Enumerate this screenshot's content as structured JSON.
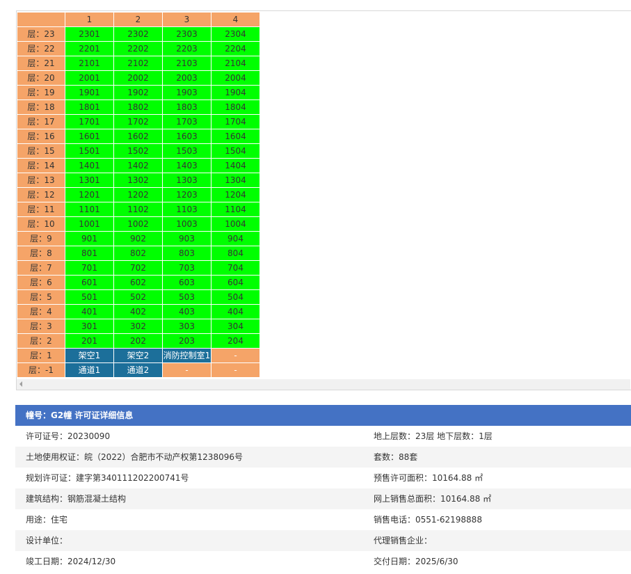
{
  "grid": {
    "columns": [
      "1",
      "2",
      "3",
      "4"
    ],
    "rows": [
      {
        "floor": "层：23",
        "units": [
          {
            "t": "2301",
            "s": "g"
          },
          {
            "t": "2302",
            "s": "g"
          },
          {
            "t": "2303",
            "s": "g"
          },
          {
            "t": "2304",
            "s": "g"
          }
        ]
      },
      {
        "floor": "层：22",
        "units": [
          {
            "t": "2201",
            "s": "g"
          },
          {
            "t": "2202",
            "s": "g"
          },
          {
            "t": "2203",
            "s": "g"
          },
          {
            "t": "2204",
            "s": "g"
          }
        ]
      },
      {
        "floor": "层：21",
        "units": [
          {
            "t": "2101",
            "s": "g"
          },
          {
            "t": "2102",
            "s": "g"
          },
          {
            "t": "2103",
            "s": "g"
          },
          {
            "t": "2104",
            "s": "g"
          }
        ]
      },
      {
        "floor": "层：20",
        "units": [
          {
            "t": "2001",
            "s": "g"
          },
          {
            "t": "2002",
            "s": "g"
          },
          {
            "t": "2003",
            "s": "g"
          },
          {
            "t": "2004",
            "s": "g"
          }
        ]
      },
      {
        "floor": "层：19",
        "units": [
          {
            "t": "1901",
            "s": "g"
          },
          {
            "t": "1902",
            "s": "g"
          },
          {
            "t": "1903",
            "s": "g"
          },
          {
            "t": "1904",
            "s": "g"
          }
        ]
      },
      {
        "floor": "层：18",
        "units": [
          {
            "t": "1801",
            "s": "g"
          },
          {
            "t": "1802",
            "s": "g"
          },
          {
            "t": "1803",
            "s": "g"
          },
          {
            "t": "1804",
            "s": "g"
          }
        ]
      },
      {
        "floor": "层：17",
        "units": [
          {
            "t": "1701",
            "s": "g"
          },
          {
            "t": "1702",
            "s": "g"
          },
          {
            "t": "1703",
            "s": "g"
          },
          {
            "t": "1704",
            "s": "g"
          }
        ]
      },
      {
        "floor": "层：16",
        "units": [
          {
            "t": "1601",
            "s": "g"
          },
          {
            "t": "1602",
            "s": "g"
          },
          {
            "t": "1603",
            "s": "g"
          },
          {
            "t": "1604",
            "s": "g"
          }
        ]
      },
      {
        "floor": "层：15",
        "units": [
          {
            "t": "1501",
            "s": "g"
          },
          {
            "t": "1502",
            "s": "g"
          },
          {
            "t": "1503",
            "s": "g"
          },
          {
            "t": "1504",
            "s": "g"
          }
        ]
      },
      {
        "floor": "层：14",
        "units": [
          {
            "t": "1401",
            "s": "g"
          },
          {
            "t": "1402",
            "s": "g"
          },
          {
            "t": "1403",
            "s": "g"
          },
          {
            "t": "1404",
            "s": "g"
          }
        ]
      },
      {
        "floor": "层：13",
        "units": [
          {
            "t": "1301",
            "s": "g"
          },
          {
            "t": "1302",
            "s": "g"
          },
          {
            "t": "1303",
            "s": "g"
          },
          {
            "t": "1304",
            "s": "g"
          }
        ]
      },
      {
        "floor": "层：12",
        "units": [
          {
            "t": "1201",
            "s": "g"
          },
          {
            "t": "1202",
            "s": "g"
          },
          {
            "t": "1203",
            "s": "g"
          },
          {
            "t": "1204",
            "s": "g"
          }
        ]
      },
      {
        "floor": "层：11",
        "units": [
          {
            "t": "1101",
            "s": "g"
          },
          {
            "t": "1102",
            "s": "g"
          },
          {
            "t": "1103",
            "s": "g"
          },
          {
            "t": "1104",
            "s": "g"
          }
        ]
      },
      {
        "floor": "层：10",
        "units": [
          {
            "t": "1001",
            "s": "g"
          },
          {
            "t": "1002",
            "s": "g"
          },
          {
            "t": "1003",
            "s": "g"
          },
          {
            "t": "1004",
            "s": "g"
          }
        ]
      },
      {
        "floor": "层：9",
        "units": [
          {
            "t": "901",
            "s": "g"
          },
          {
            "t": "902",
            "s": "g"
          },
          {
            "t": "903",
            "s": "g"
          },
          {
            "t": "904",
            "s": "g"
          }
        ]
      },
      {
        "floor": "层：8",
        "units": [
          {
            "t": "801",
            "s": "g"
          },
          {
            "t": "802",
            "s": "g"
          },
          {
            "t": "803",
            "s": "g"
          },
          {
            "t": "804",
            "s": "g"
          }
        ]
      },
      {
        "floor": "层：7",
        "units": [
          {
            "t": "701",
            "s": "g"
          },
          {
            "t": "702",
            "s": "g"
          },
          {
            "t": "703",
            "s": "g"
          },
          {
            "t": "704",
            "s": "g"
          }
        ]
      },
      {
        "floor": "层：6",
        "units": [
          {
            "t": "601",
            "s": "g"
          },
          {
            "t": "602",
            "s": "g"
          },
          {
            "t": "603",
            "s": "g"
          },
          {
            "t": "604",
            "s": "g"
          }
        ]
      },
      {
        "floor": "层：5",
        "units": [
          {
            "t": "501",
            "s": "g"
          },
          {
            "t": "502",
            "s": "g"
          },
          {
            "t": "503",
            "s": "g"
          },
          {
            "t": "504",
            "s": "g"
          }
        ]
      },
      {
        "floor": "层：4",
        "units": [
          {
            "t": "401",
            "s": "g"
          },
          {
            "t": "402",
            "s": "g"
          },
          {
            "t": "403",
            "s": "g"
          },
          {
            "t": "404",
            "s": "g"
          }
        ]
      },
      {
        "floor": "层：3",
        "units": [
          {
            "t": "301",
            "s": "g"
          },
          {
            "t": "302",
            "s": "g"
          },
          {
            "t": "303",
            "s": "g"
          },
          {
            "t": "304",
            "s": "g"
          }
        ]
      },
      {
        "floor": "层：2",
        "units": [
          {
            "t": "201",
            "s": "g"
          },
          {
            "t": "202",
            "s": "g"
          },
          {
            "t": "203",
            "s": "g"
          },
          {
            "t": "204",
            "s": "g"
          }
        ]
      },
      {
        "floor": "层：1",
        "units": [
          {
            "t": "架空1",
            "s": "b"
          },
          {
            "t": "架空2",
            "s": "b"
          },
          {
            "t": "消防控制室1",
            "s": "b"
          },
          {
            "t": "-",
            "s": "o"
          }
        ]
      },
      {
        "floor": "层：-1",
        "units": [
          {
            "t": "通道1",
            "s": "b"
          },
          {
            "t": "通道2",
            "s": "b"
          },
          {
            "t": "-",
            "s": "o"
          },
          {
            "t": "-",
            "s": "o"
          }
        ]
      }
    ],
    "status_colors": {
      "available": "#00ff00",
      "facility": "#1c6f9a",
      "empty": "#f5a468"
    }
  },
  "info": {
    "title": "幢号：G2幢 许可证详细信息",
    "rows": [
      {
        "left": "许可证号：20230090",
        "right": "地上层数：23层  地下层数：1层"
      },
      {
        "left": "土地使用权证：皖（2022）合肥市不动产权第1238096号",
        "right": "套数：88套"
      },
      {
        "left": "规划许可证：建字第340111202200741号",
        "right": "预售许可面积：10164.88 ㎡"
      },
      {
        "left": "建筑结构：钢筋混凝土结构",
        "right": "网上销售总面积：10164.88 ㎡"
      },
      {
        "left": "用途：住宅",
        "right": "销售电话：0551-62198888"
      },
      {
        "left": "设计单位：",
        "right": "代理销售企业："
      },
      {
        "left": "竣工日期：2024/12/30",
        "right": "交付日期：2025/6/30"
      }
    ]
  },
  "colors": {
    "header_blue": "#4472c4",
    "alt_row": "#f4f4f4"
  }
}
